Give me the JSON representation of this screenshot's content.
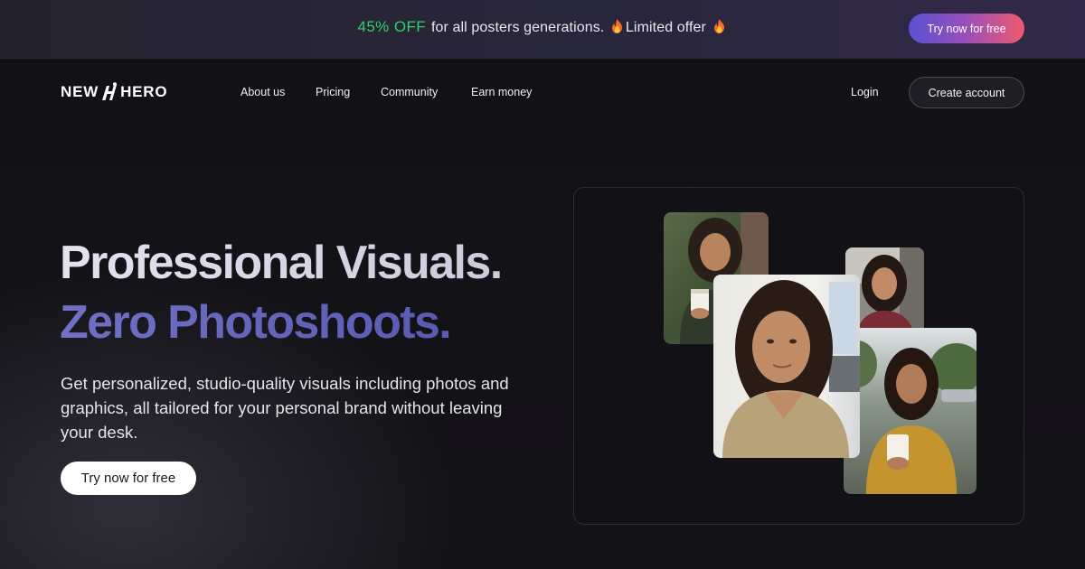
{
  "promo": {
    "discount": "45% OFF",
    "text": "for all posters generations.",
    "limited": "Limited offer",
    "flame_icon": "fire-emoji",
    "cta": "Try now for free",
    "discount_color": "#2fcf6d"
  },
  "nav": {
    "logo_left": "NEW",
    "logo_right": "HERO",
    "links": [
      "About us",
      "Pricing",
      "Community",
      "Earn money"
    ],
    "login": "Login",
    "create_account": "Create account"
  },
  "hero": {
    "headline_line1": "Professional Visuals.",
    "headline_line2": "Zero Photoshoots.",
    "subtext": "Get personalized, studio-quality visuals including photos and graphics, all tailored for your personal brand without leaving your desk.",
    "cta": "Try now for free",
    "accent_color": "#6467bd"
  },
  "showcase": {
    "images": [
      "portrait-outdoor-coffee",
      "portrait-closeup-office",
      "portrait-car-selfie",
      "portrait-street-coffee-sweater"
    ]
  }
}
